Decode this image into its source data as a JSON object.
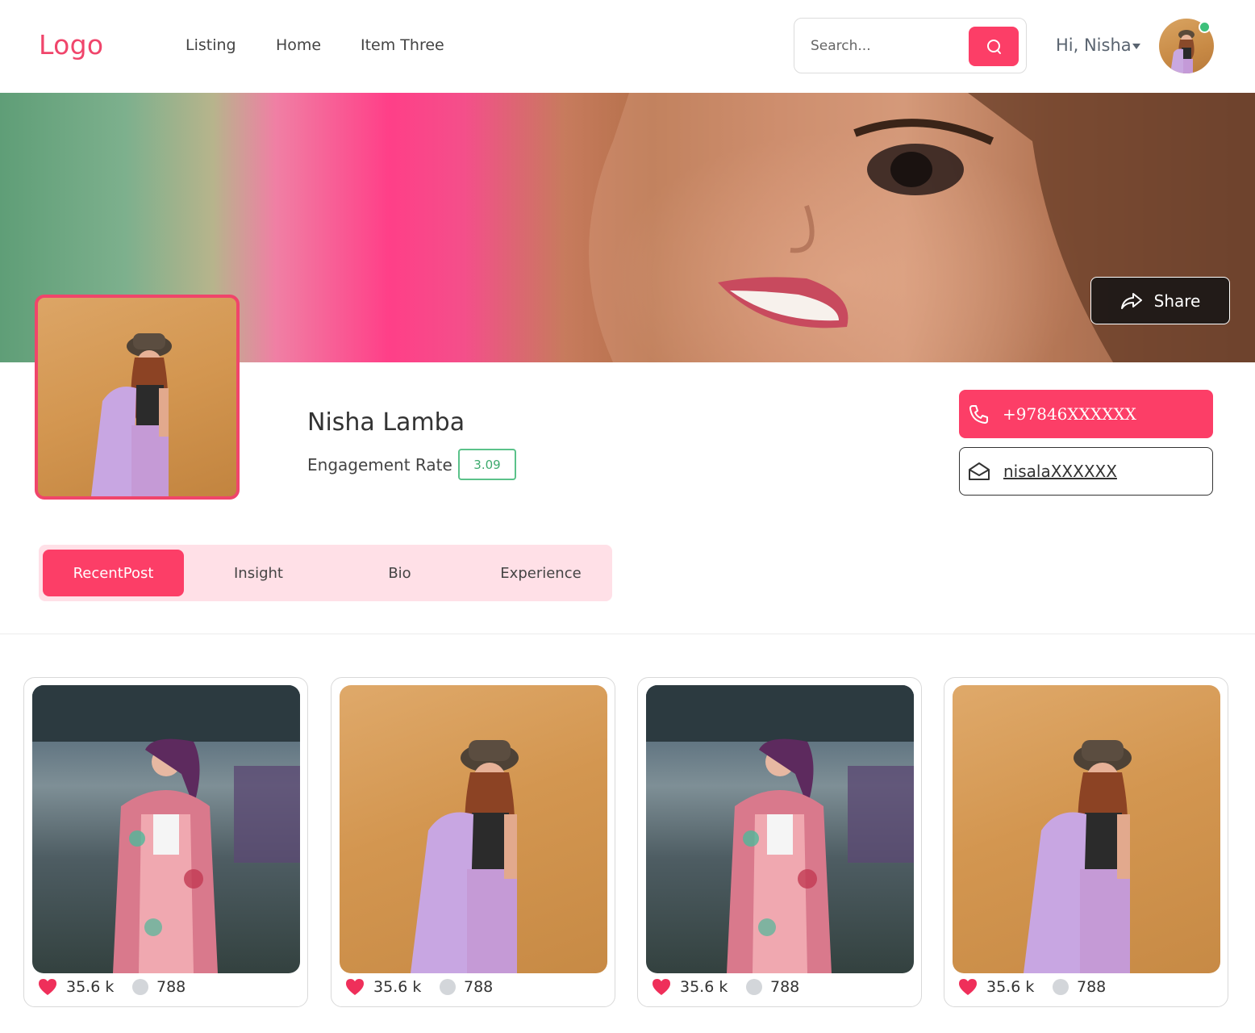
{
  "header": {
    "logo": "Logo",
    "nav": [
      "Listing",
      "Home",
      "Item Three"
    ],
    "search_placeholder": "Search...",
    "greeting": "Hi, Nisha"
  },
  "banner": {
    "share_label": "Share"
  },
  "profile": {
    "name": "Nisha Lamba",
    "engagement_label": "Engagement Rate",
    "engagement_value": "3.09",
    "phone": "+97846XXXXXX",
    "email": "nisalaXXXXXX"
  },
  "tabs": [
    {
      "label": "RecentPost",
      "active": true
    },
    {
      "label": "Insight",
      "active": false
    },
    {
      "label": "Bio",
      "active": false
    },
    {
      "label": "Experience",
      "active": false
    }
  ],
  "posts": [
    {
      "likes": "35.6 k",
      "comments": "788",
      "photo": "street"
    },
    {
      "likes": "35.6 k",
      "comments": "788",
      "photo": "studio"
    },
    {
      "likes": "35.6 k",
      "comments": "788",
      "photo": "street"
    },
    {
      "likes": "35.6 k",
      "comments": "788",
      "photo": "studio"
    }
  ],
  "colors": {
    "accent": "#fc3e67",
    "accent_light": "#ffe0e7",
    "online": "#3ec07b",
    "engagement": "#5bc28a"
  },
  "icons": {
    "search": "search-icon",
    "share": "share-icon",
    "phone": "phone-icon",
    "mail": "mail-icon",
    "like": "heart-icon",
    "comment": "comment-dot-icon"
  }
}
